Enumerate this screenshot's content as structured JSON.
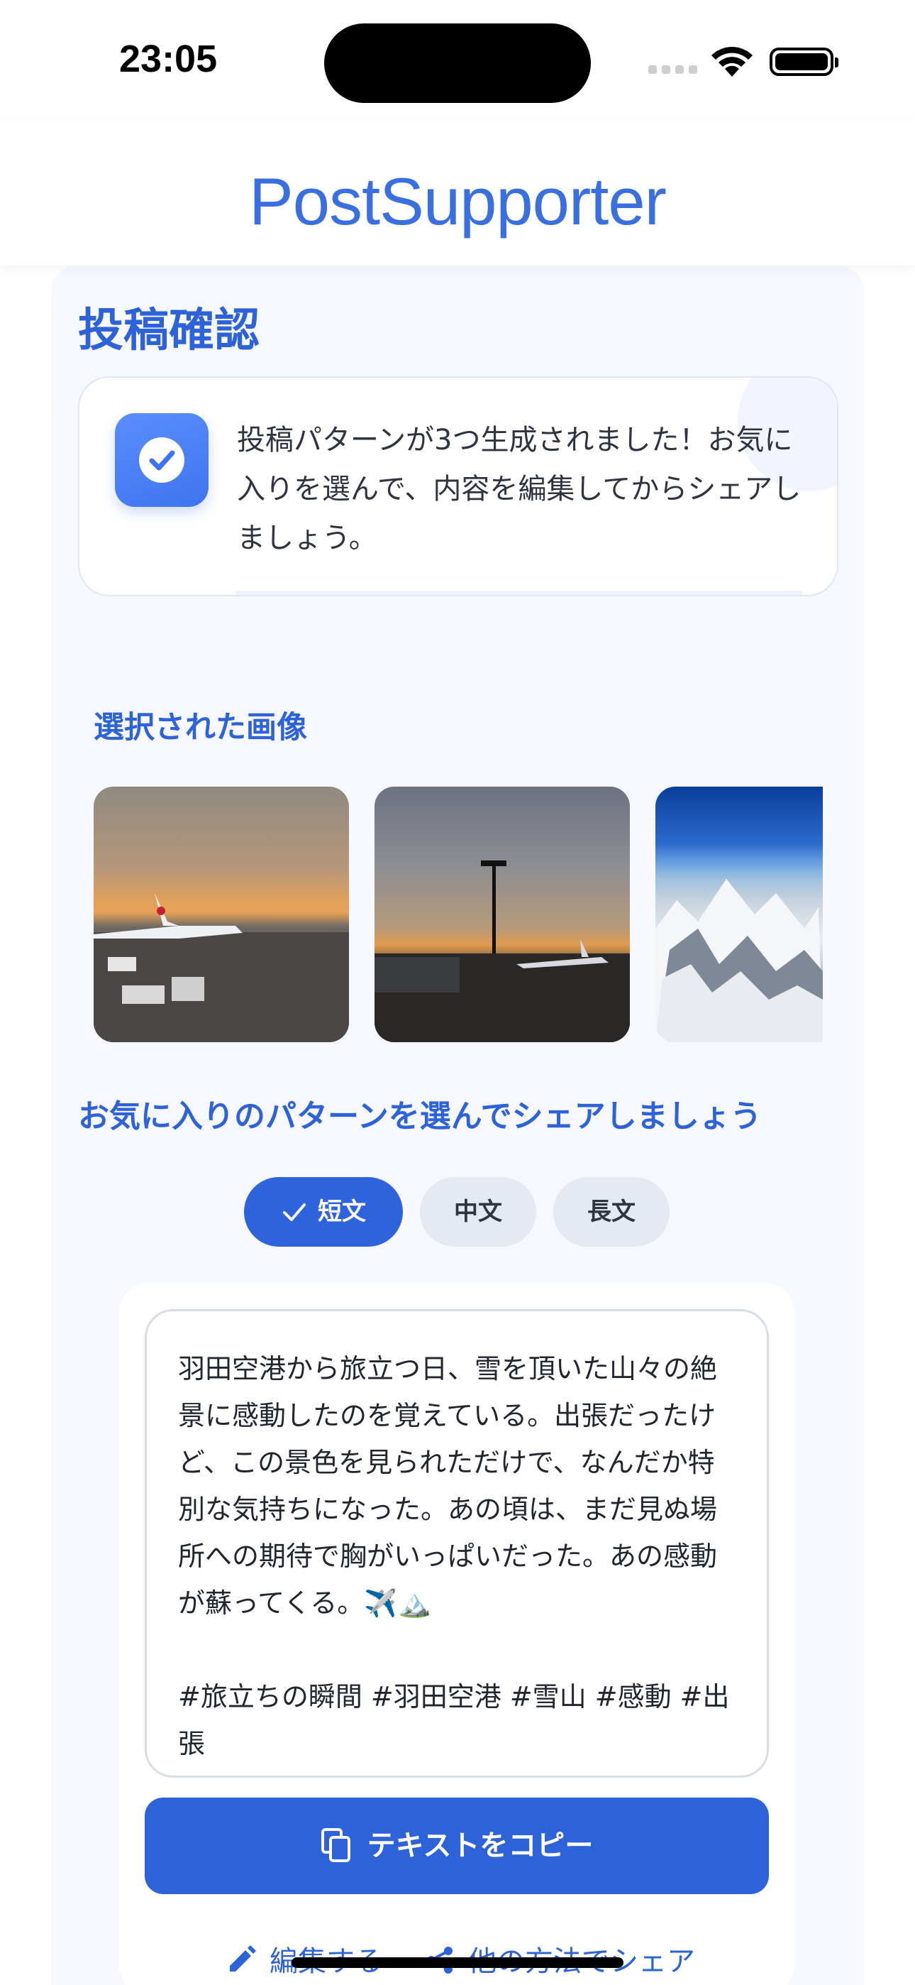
{
  "status_bar": {
    "time": "23:05"
  },
  "header": {
    "app_title": "PostSupporter"
  },
  "page": {
    "title": "投稿確認",
    "info_message": "投稿パターンが3つ生成されました！お気に入りを選んで、内容を編集してからシェアしましょう。",
    "selected_images_title": "選択された画像",
    "pattern_prompt": "お気に入りのパターンを選んでシェアしましょう"
  },
  "tabs": [
    {
      "label": "短文",
      "selected": true
    },
    {
      "label": "中文",
      "selected": false
    },
    {
      "label": "長文",
      "selected": false
    }
  ],
  "post": {
    "text": "羽田空港から旅立つ日、雪を頂いた山々の絶景に感動したのを覚えている。出張だったけど、この景色を見られただけで、なんだか特別な気持ちになった。あの頃は、まだ見ぬ場所への期待で胸がいっぱいだった。あの感動が蘇ってくる。✈️🏔️\n\n#旅立ちの瞬間 #羽田空港 #雪山 #感動 #出張"
  },
  "buttons": {
    "copy": "テキストをコピー",
    "edit": "編集する",
    "share_other": "他の方法でシェア"
  },
  "colors": {
    "accent": "#2e62d8",
    "title_blue": "#3a6fe0",
    "tab_inactive": "#e5e9f2"
  }
}
